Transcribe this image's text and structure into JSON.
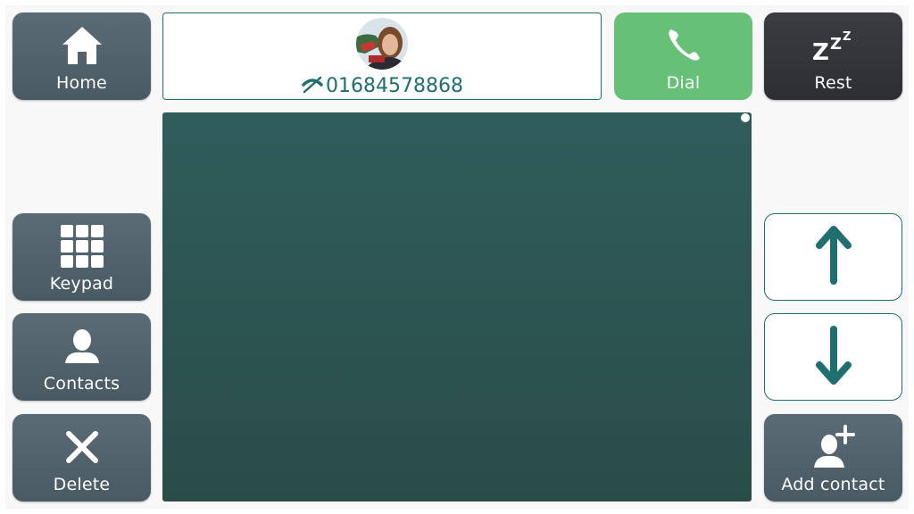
{
  "colors": {
    "slate_button": "#52626c",
    "dial_green": "#66c077",
    "rest_dark": "#333539",
    "teal_accent": "#1f6e70",
    "panel_teal": "#2d5553"
  },
  "left_buttons": {
    "home": {
      "label": "Home",
      "icon": "home-icon"
    },
    "keypad": {
      "label": "Keypad",
      "icon": "keypad-grid-icon"
    },
    "contacts": {
      "label": "Contacts",
      "icon": "person-icon"
    },
    "delete": {
      "label": "Delete",
      "icon": "x-icon"
    }
  },
  "number_display": {
    "number": "01684578868",
    "icon": "phone-off-icon",
    "avatar": "contact-photo"
  },
  "top_right_buttons": {
    "dial": {
      "label": "Dial",
      "icon": "phone-handset-icon"
    },
    "rest": {
      "label": "Rest",
      "icon": "sleep-zzz-icon"
    }
  },
  "right_buttons": {
    "up": {
      "icon": "arrow-up-icon"
    },
    "down": {
      "icon": "arrow-down-icon"
    },
    "add_contact": {
      "label": "Add contact",
      "icon": "add-person-icon"
    }
  }
}
